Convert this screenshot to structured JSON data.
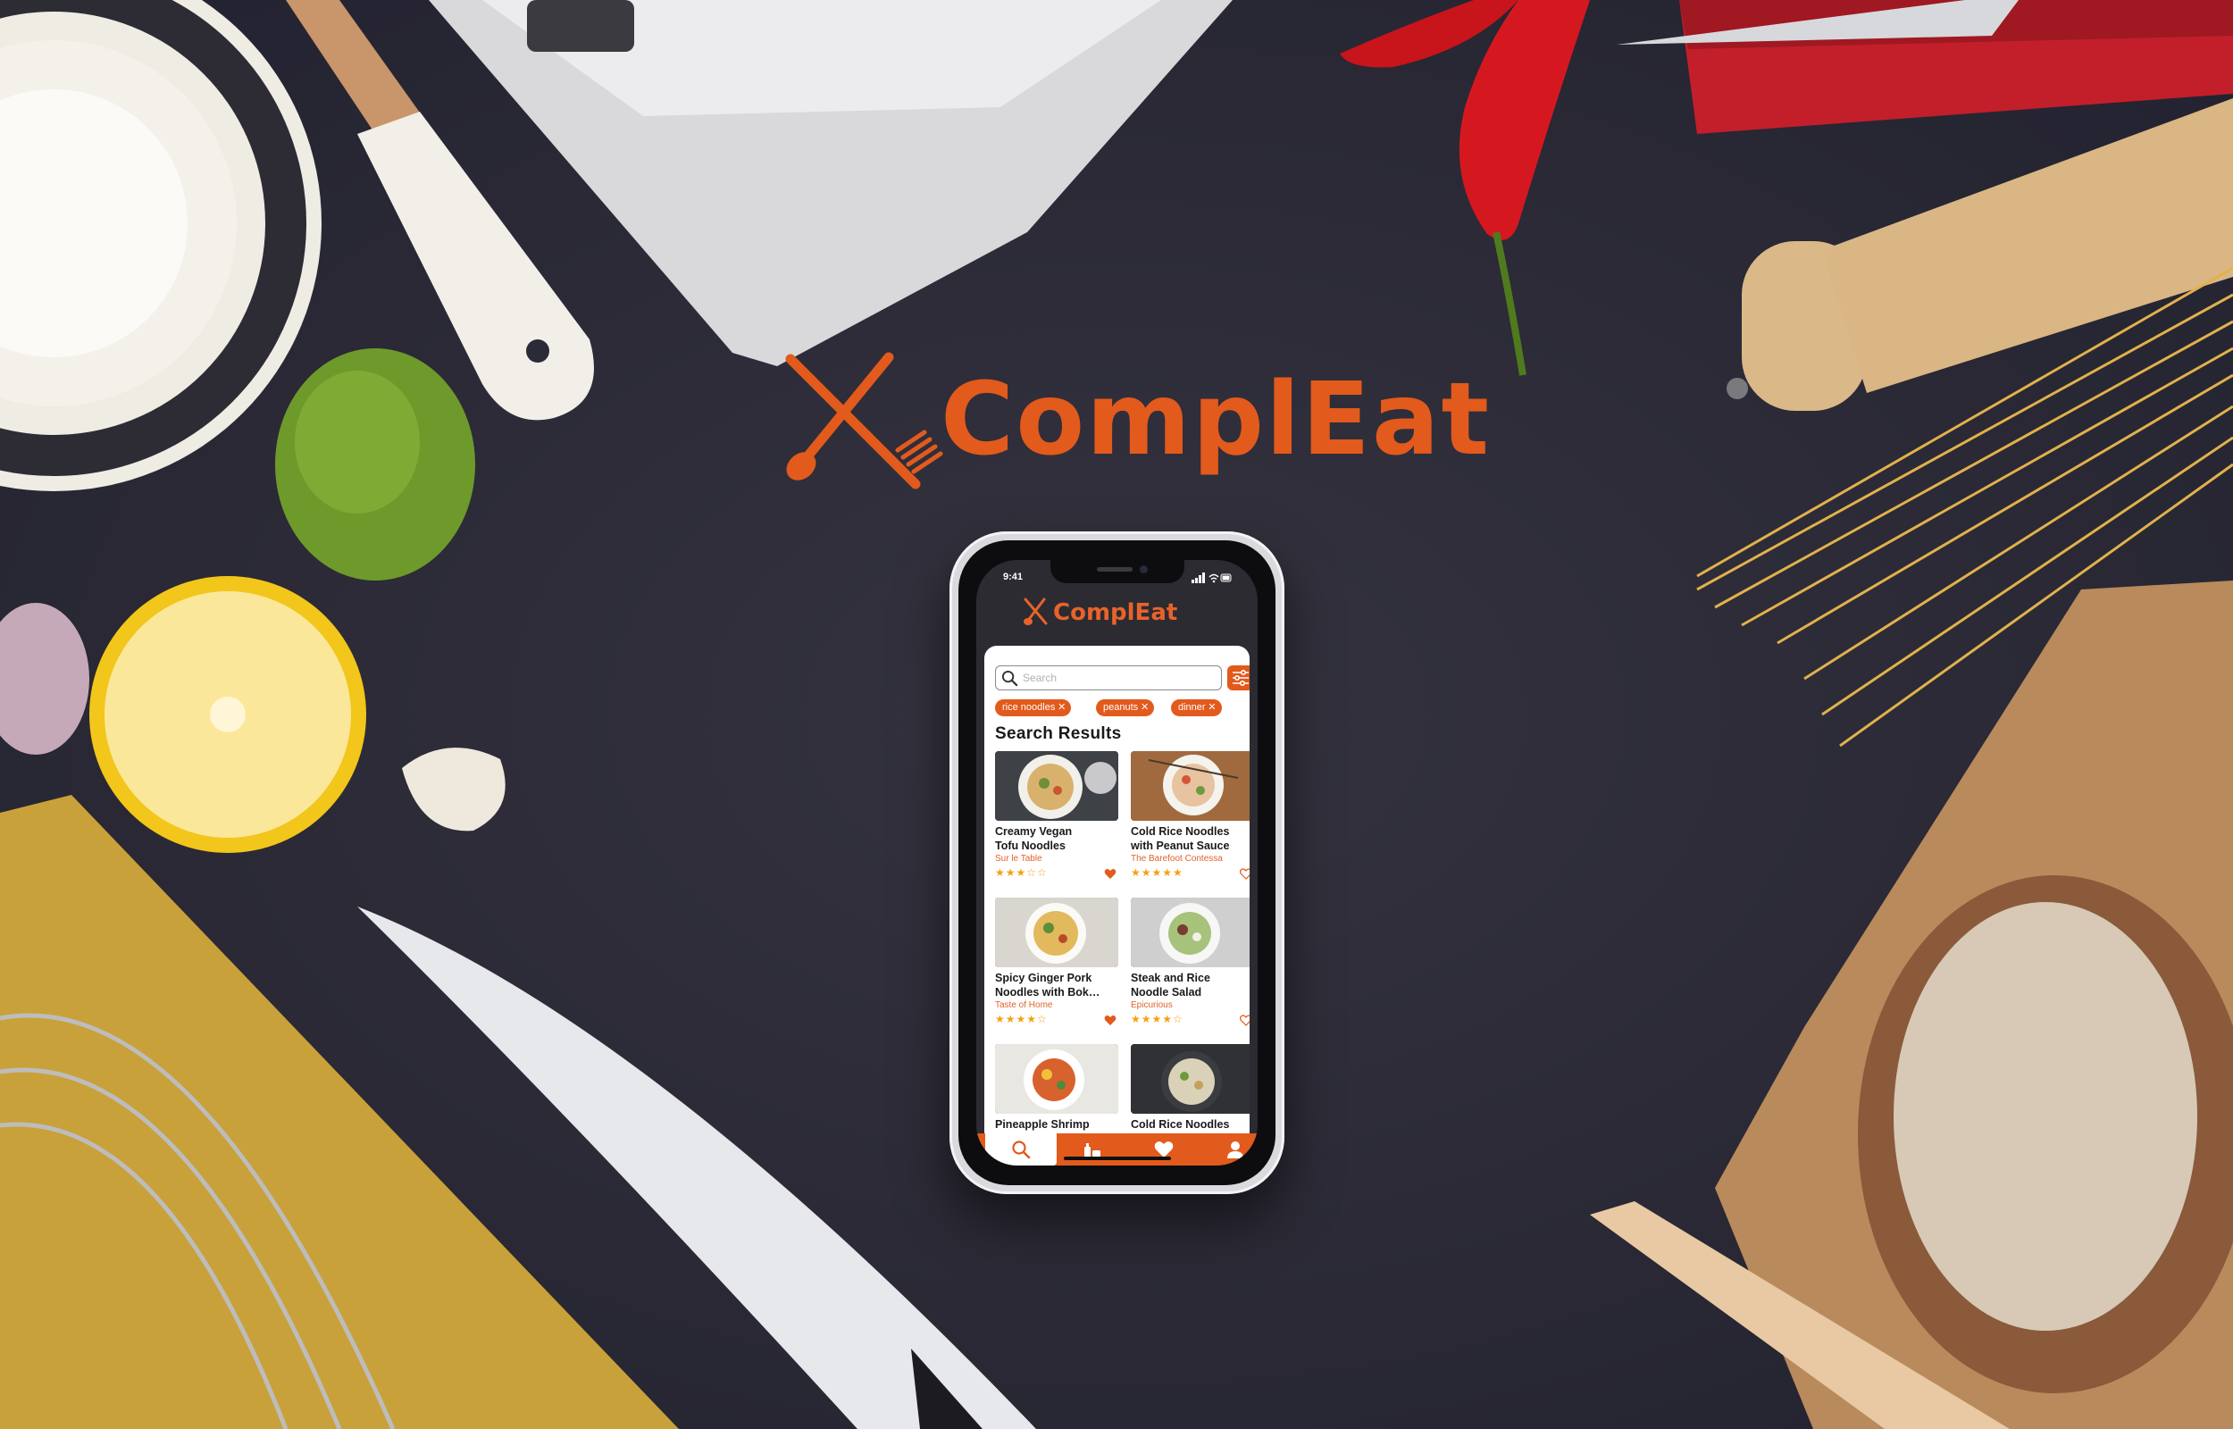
{
  "brand": {
    "name": "ComplEat",
    "accent": "#e25a1c"
  },
  "phone": {
    "status": {
      "time": "9:41"
    },
    "app": {
      "title": "ComplEat",
      "search": {
        "placeholder": "Search",
        "value": ""
      },
      "filter_icon": "sliders-icon",
      "chips": [
        {
          "label": "rice noodles"
        },
        {
          "label": "peanuts"
        },
        {
          "label": "dinner"
        }
      ],
      "results_heading": "Search Results",
      "cards": [
        {
          "title": "Creamy Vegan\nTofu Noodles",
          "source": "Sur le Table",
          "stars": "★★★☆☆",
          "rating": 3,
          "favorited": true
        },
        {
          "title": "Cold Rice Noodles\nwith Peanut Sauce",
          "source": "The Barefoot Contessa",
          "stars": "★★★★★",
          "rating": 5,
          "favorited": false
        },
        {
          "title": "Spicy Ginger Pork\nNoodles with Bok…",
          "source": "Taste of Home",
          "stars": "★★★★☆",
          "rating": 4,
          "favorited": true
        },
        {
          "title": "Steak and Rice\nNoodle Salad",
          "source": "Epicurious",
          "stars": "★★★★☆",
          "rating": 4,
          "favorited": false
        },
        {
          "title": "Pineapple Shrimp\nNoodle Bowls",
          "source": "",
          "stars": "",
          "rating": null,
          "favorited": false
        },
        {
          "title": "Cold Rice Noodles\nwith Coconut Milk",
          "source": "",
          "stars": "",
          "rating": null,
          "favorited": false
        }
      ],
      "tabs": [
        {
          "icon": "search-icon",
          "active": true
        },
        {
          "icon": "pantry-icon",
          "active": false
        },
        {
          "icon": "heart-icon",
          "active": false
        },
        {
          "icon": "profile-icon",
          "active": false
        }
      ]
    }
  }
}
